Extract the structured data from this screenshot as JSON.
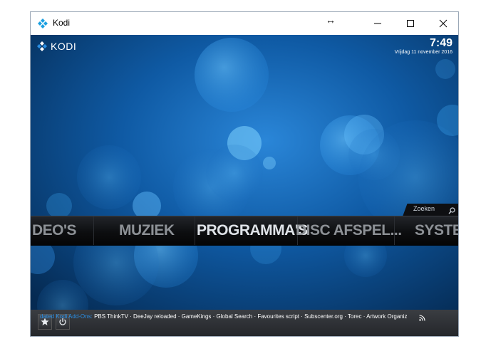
{
  "window": {
    "title": "Kodi",
    "resize_hint": "↔",
    "controls": {
      "minimize": "—",
      "maximize": "☐",
      "close": "✕"
    }
  },
  "kodi": {
    "logo_text": "KODI",
    "time": "7:49",
    "date": "Vrijdag 11 november 2016",
    "search_label": "Zoeken",
    "menu_items": [
      {
        "label": "DEO'S"
      },
      {
        "label": "MUZIEK"
      },
      {
        "label": "PROGRAMMA'S"
      },
      {
        "label": "DISC AFSPEL..."
      },
      {
        "label": "SYSTE"
      }
    ],
    "ticker": {
      "highlight": "dated Kodi Add-Ons: ",
      "items": "PBS ThinkTV · DeeJay reloaded · GameKings · Global Search · Favourites script · Subscenter.org · Torec · Artwork Organizer · Mim"
    },
    "icons": [
      "star-icon",
      "power-icon",
      "search-icon",
      "rss-icon",
      "kodi-logo-icon"
    ],
    "colors": {
      "background": "#0a3f74",
      "accent": "#2a8fe5",
      "menu_active": "#dfe3e8"
    }
  }
}
